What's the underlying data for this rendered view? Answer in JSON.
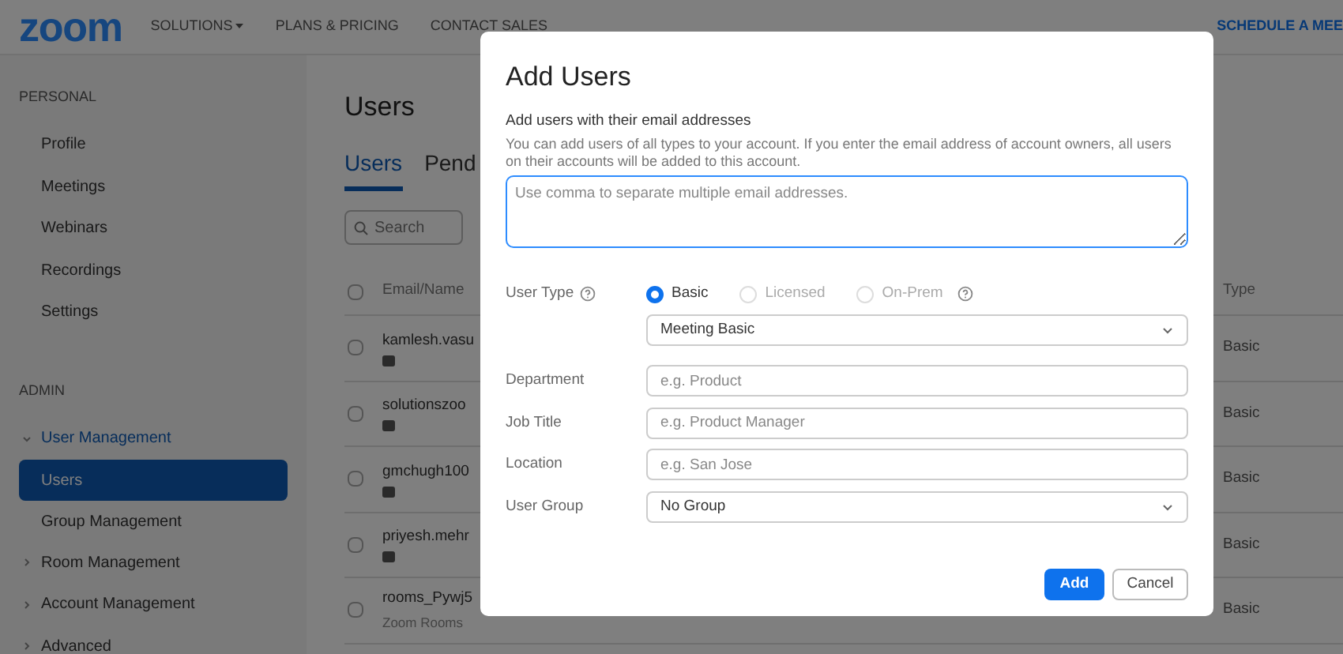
{
  "header": {
    "logo": "zoom",
    "nav": [
      {
        "label": "SOLUTIONS",
        "dropdown": true
      },
      {
        "label": "PLANS & PRICING",
        "dropdown": false
      },
      {
        "label": "CONTACT SALES",
        "dropdown": false
      }
    ],
    "cta": "SCHEDULE A MEE"
  },
  "sidebar": {
    "sections": [
      {
        "title": "PERSONAL",
        "items": [
          {
            "label": "Profile",
            "selected": false
          },
          {
            "label": "Meetings",
            "selected": false
          },
          {
            "label": "Webinars",
            "selected": false
          },
          {
            "label": "Recordings",
            "selected": false
          },
          {
            "label": "Settings",
            "selected": false
          }
        ]
      },
      {
        "title": "ADMIN",
        "items": [
          {
            "label": "User Management",
            "selected": false,
            "expanded": true,
            "children": [
              {
                "label": "Users",
                "selected": true
              },
              {
                "label": "Group Management",
                "selected": false
              }
            ]
          },
          {
            "label": "Room Management",
            "selected": false,
            "expanded": false
          },
          {
            "label": "Account Management",
            "selected": false,
            "expanded": false
          },
          {
            "label": "Advanced",
            "selected": false,
            "expanded": false
          }
        ]
      }
    ]
  },
  "page": {
    "title": "Users",
    "tabs": [
      {
        "label": "Users",
        "selected": true
      },
      {
        "label": "Pend",
        "selected": false
      }
    ],
    "search": {
      "placeholder": "Search"
    }
  },
  "table": {
    "select_all": {
      "checked": false
    },
    "columns": [
      "Email/Name",
      "Type"
    ],
    "rows": [
      {
        "kind": "user",
        "checked": false,
        "email": "kamlesh.vasu",
        "type": "Basic"
      },
      {
        "kind": "user",
        "checked": false,
        "email": "solutionszoo",
        "type": "Basic"
      },
      {
        "kind": "user",
        "checked": false,
        "email": "gmchugh100",
        "type": "Basic"
      },
      {
        "kind": "user",
        "checked": false,
        "email": "priyesh.mehr",
        "type": "Basic"
      },
      {
        "kind": "room",
        "checked": false,
        "email": "rooms_Pywj5",
        "subtitle": "Zoom Rooms",
        "type": "Basic"
      }
    ]
  },
  "dialog": {
    "title": "Add Users",
    "subtitle": "Add users with their email addresses",
    "description": "You can add users of all types to your account. If you enter the email address of account owners, all users on their accounts will be added to this account.",
    "emails": {
      "placeholder": "Use comma to separate multiple email addresses."
    },
    "user_type": {
      "label": "User Type",
      "options": [
        {
          "label": "Basic",
          "selected": true,
          "disabled": false,
          "help": false
        },
        {
          "label": "Licensed",
          "selected": false,
          "disabled": true,
          "help": false
        },
        {
          "label": "On-Prem",
          "selected": false,
          "disabled": true,
          "help": true
        }
      ],
      "select": "Meeting Basic"
    },
    "fields": [
      {
        "kind": "input",
        "label": "Department",
        "placeholder": "e.g. Product"
      },
      {
        "kind": "input",
        "label": "Job Title",
        "placeholder": "e.g. Product Manager"
      },
      {
        "kind": "input",
        "label": "Location",
        "placeholder": "e.g. San Jose"
      },
      {
        "kind": "select",
        "label": "User Group",
        "value": "No Group"
      }
    ],
    "buttons": [
      {
        "label": "Add",
        "kind": "primary"
      },
      {
        "label": "Cancel",
        "kind": "secondary"
      }
    ]
  }
}
